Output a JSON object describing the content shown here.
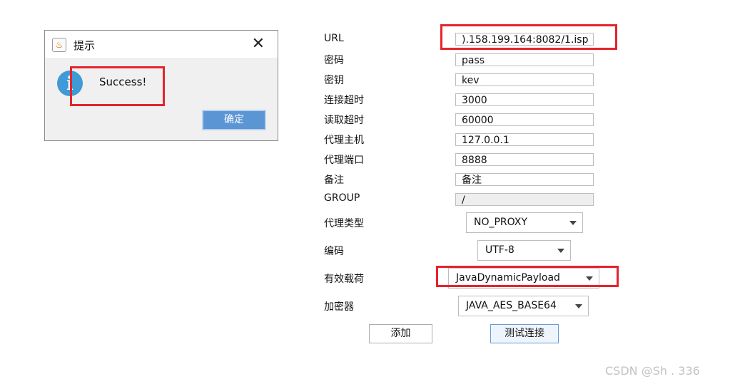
{
  "dialog": {
    "title": "提示",
    "close_glyph": "✕",
    "app_icon_glyph": "♨",
    "info_glyph": "i",
    "message": "Success!",
    "ok_label": "确定"
  },
  "form": {
    "labels": {
      "url": "URL",
      "password": "密码",
      "secret_key": "密钥",
      "connect_timeout": "连接超时",
      "read_timeout": "读取超时",
      "proxy_host": "代理主机",
      "proxy_port": "代理端口",
      "remark": "备注",
      "group": "GROUP",
      "proxy_type": "代理类型",
      "encoding": "编码",
      "payload": "有效载荷",
      "cryption": "加密器"
    },
    "values": {
      "url": ").158.199.164:8082/1.isp",
      "password": "pass",
      "secret_key": "kev",
      "connect_timeout": "3000",
      "read_timeout": "60000",
      "proxy_host": "127.0.0.1",
      "proxy_port": "8888",
      "remark": "备注",
      "group": "/",
      "proxy_type": "NO_PROXY",
      "encoding": "UTF-8",
      "payload": "JavaDynamicPayload",
      "cryption": "JAVA_AES_BASE64"
    },
    "buttons": {
      "add": "添加",
      "test": "测试连接"
    }
  },
  "watermark": "CSDN @Sh    . 336",
  "colors": {
    "annotation_red": "#e5232b",
    "ok_button": "#5b95d4",
    "info_icon": "#3f9ad6"
  }
}
